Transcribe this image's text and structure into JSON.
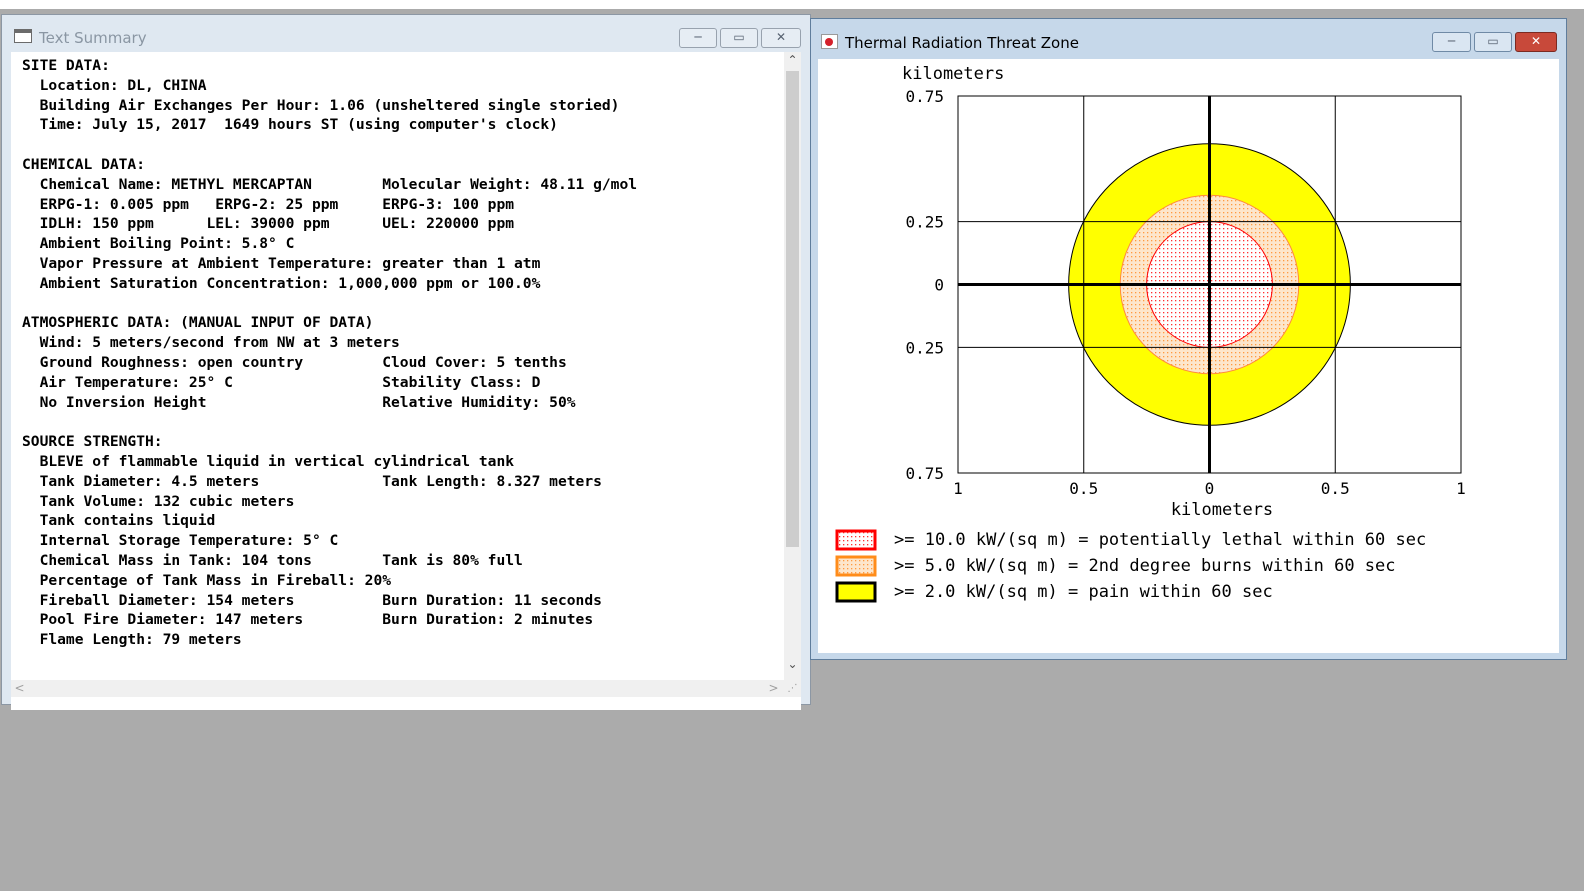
{
  "text_window": {
    "title": "Text Summary",
    "controls": {
      "minimize": "─",
      "maximize": "▭",
      "close": "✕"
    },
    "scroll_up": "⌃",
    "scroll_down": "⌄",
    "scroll_left": "<",
    "scroll_right": ">",
    "lines": [
      "SITE DATA:",
      "  Location: DL, CHINA",
      "  Building Air Exchanges Per Hour: 1.06 (unsheltered single storied)",
      "  Time: July 15, 2017  1649 hours ST (using computer's clock)",
      "",
      "CHEMICAL DATA:",
      "  Chemical Name: METHYL MERCAPTAN        Molecular Weight: 48.11 g/mol",
      "  ERPG-1: 0.005 ppm   ERPG-2: 25 ppm     ERPG-3: 100 ppm",
      "  IDLH: 150 ppm      LEL: 39000 ppm      UEL: 220000 ppm",
      "  Ambient Boiling Point: 5.8° C",
      "  Vapor Pressure at Ambient Temperature: greater than 1 atm",
      "  Ambient Saturation Concentration: 1,000,000 ppm or 100.0%",
      "",
      "ATMOSPHERIC DATA: (MANUAL INPUT OF DATA)",
      "  Wind: 5 meters/second from NW at 3 meters",
      "  Ground Roughness: open country         Cloud Cover: 5 tenths",
      "  Air Temperature: 25° C                 Stability Class: D",
      "  No Inversion Height                    Relative Humidity: 50%",
      "",
      "SOURCE STRENGTH:",
      "  BLEVE of flammable liquid in vertical cylindrical tank",
      "  Tank Diameter: 4.5 meters              Tank Length: 8.327 meters",
      "  Tank Volume: 132 cubic meters",
      "  Tank contains liquid",
      "  Internal Storage Temperature: 5° C",
      "  Chemical Mass in Tank: 104 tons        Tank is 80% full",
      "  Percentage of Tank Mass in Fireball: 20%",
      "  Fireball Diameter: 154 meters          Burn Duration: 11 seconds",
      "  Pool Fire Diameter: 147 meters         Burn Duration: 2 minutes",
      "  Flame Length: 79 meters"
    ]
  },
  "threat_window": {
    "title": "Thermal Radiation Threat Zone",
    "controls": {
      "minimize": "─",
      "maximize": "▭",
      "close": "✕"
    }
  },
  "chart_data": {
    "type": "threat_zone_plot",
    "ylabel": "kilometers",
    "xlabel": "kilometers",
    "xlim": [
      -1,
      1
    ],
    "ylim": [
      -0.75,
      0.75
    ],
    "x_tick_values": [
      -1,
      -0.5,
      0,
      0.5,
      1
    ],
    "x_tick_labels": [
      "1",
      "0.5",
      "0",
      "0.5",
      "1"
    ],
    "y_tick_values": [
      0.75,
      0.25,
      0,
      -0.25,
      -0.75
    ],
    "y_tick_labels": [
      "0.75",
      "0.25",
      "0",
      "0.25",
      "0.75"
    ],
    "grid": true,
    "zones": [
      {
        "name": ">= 2.0 kW/(sq m) = pain within 60 sec",
        "radius_km": 0.56,
        "fill": "#ffff00",
        "stroke": "#000000",
        "pattern": "solid"
      },
      {
        "name": ">= 5.0 kW/(sq m) = 2nd degree burns within 60 sec",
        "radius_km": 0.355,
        "fill": "#fbe2c6",
        "stroke": "#ff8a3c",
        "pattern": "dotted-orange"
      },
      {
        "name": ">= 10.0 kW/(sq m) = potentially lethal within 60 sec",
        "radius_km": 0.25,
        "fill": "#ffffff",
        "stroke": "#ff0000",
        "pattern": "dotted-red"
      }
    ],
    "legend": [
      {
        "label": ">= 10.0 kW/(sq m) = potentially lethal within 60 sec",
        "border": "#ff0000",
        "pattern": "dotted-red"
      },
      {
        "label": ">= 5.0 kW/(sq m) = 2nd degree burns within 60 sec",
        "border": "#ff8c1a",
        "pattern": "dotted-orange"
      },
      {
        "label": ">= 2.0 kW/(sq m) = pain within 60 sec",
        "border": "#000000",
        "pattern": "solid-yellow"
      }
    ],
    "legend_position": "bottom"
  }
}
